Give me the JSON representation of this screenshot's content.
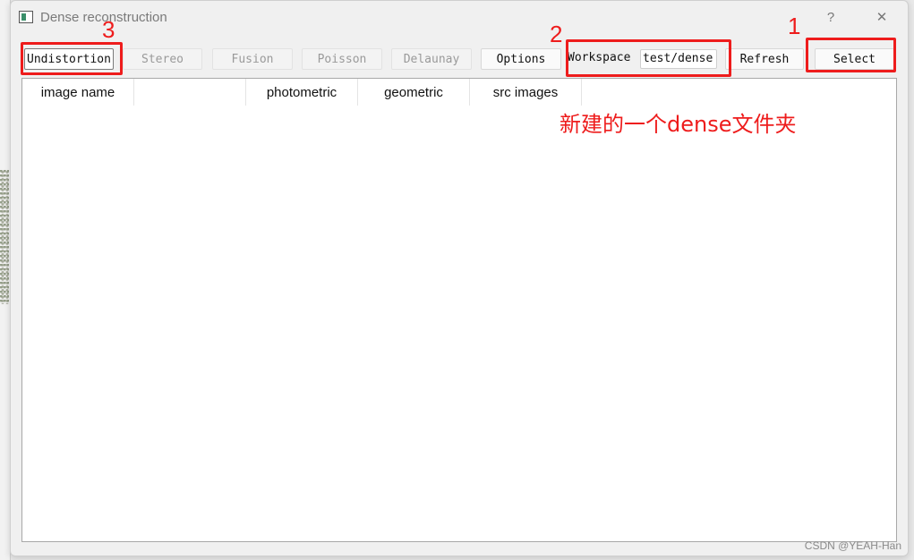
{
  "window": {
    "title": "Dense reconstruction",
    "help_label": "?",
    "close_label": "✕"
  },
  "toolbar": {
    "undistortion_label": "Undistortion",
    "stereo_label": "Stereo",
    "fusion_label": "Fusion",
    "poisson_label": "Poisson",
    "delaunay_label": "Delaunay",
    "options_label": "Options",
    "workspace_label": "Workspace",
    "workspace_value": "test/dense",
    "refresh_label": "Refresh",
    "select_label": "Select"
  },
  "table": {
    "columns": [
      "image name",
      "",
      "photometric",
      "geometric",
      "src images"
    ]
  },
  "annotations": {
    "step1": "1",
    "step2": "2",
    "step3": "3",
    "note": "新建的一个dense文件夹",
    "color": "#ee1c1c"
  },
  "watermark": "CSDN @YEAH-Han"
}
